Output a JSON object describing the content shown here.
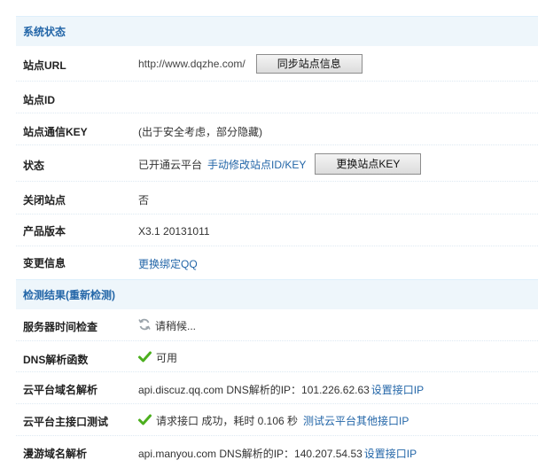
{
  "sections": {
    "system_status": "系统状态",
    "check_results": "检测结果(重新检测)"
  },
  "rows": {
    "site_url": {
      "label": "站点URL",
      "value": "http://www.dqzhe.com/",
      "button": "同步站点信息"
    },
    "site_id": {
      "label": "站点ID"
    },
    "site_key": {
      "label": "站点通信KEY",
      "value": "(出于安全考虑，部分隐藏)"
    },
    "status": {
      "label": "状态",
      "value": "已开通云平台",
      "link": "手动修改站点ID/KEY",
      "button": "更换站点KEY"
    },
    "close_site": {
      "label": "关闭站点",
      "value": "否"
    },
    "version": {
      "label": "产品版本",
      "value": "X3.1 20131011"
    },
    "change_info": {
      "label": "变更信息",
      "link": "更换绑定QQ"
    },
    "server_time": {
      "label": "服务器时间检查",
      "value": "请稍候..."
    },
    "dns_func": {
      "label": "DNS解析函数",
      "value": "可用"
    },
    "cloud_dns": {
      "label": "云平台域名解析",
      "value": "api.discuz.qq.com DNS解析的IP：101.226.62.63",
      "link": "设置接口IP"
    },
    "cloud_main": {
      "label": "云平台主接口测试",
      "value": "请求接口 成功，耗时 0.106 秒",
      "link": "测试云平台其他接口IP"
    },
    "manyou_dns": {
      "label": "漫游域名解析",
      "value": "api.manyou.com DNS解析的IP：140.207.54.53",
      "link": "设置接口IP"
    }
  },
  "icons": {
    "loading": "refresh-icon",
    "ok": "checkmark-icon",
    "ok_color": "#4caf1e"
  },
  "colors": {
    "link": "#2366a8",
    "section_bg": "#eef6fb"
  }
}
